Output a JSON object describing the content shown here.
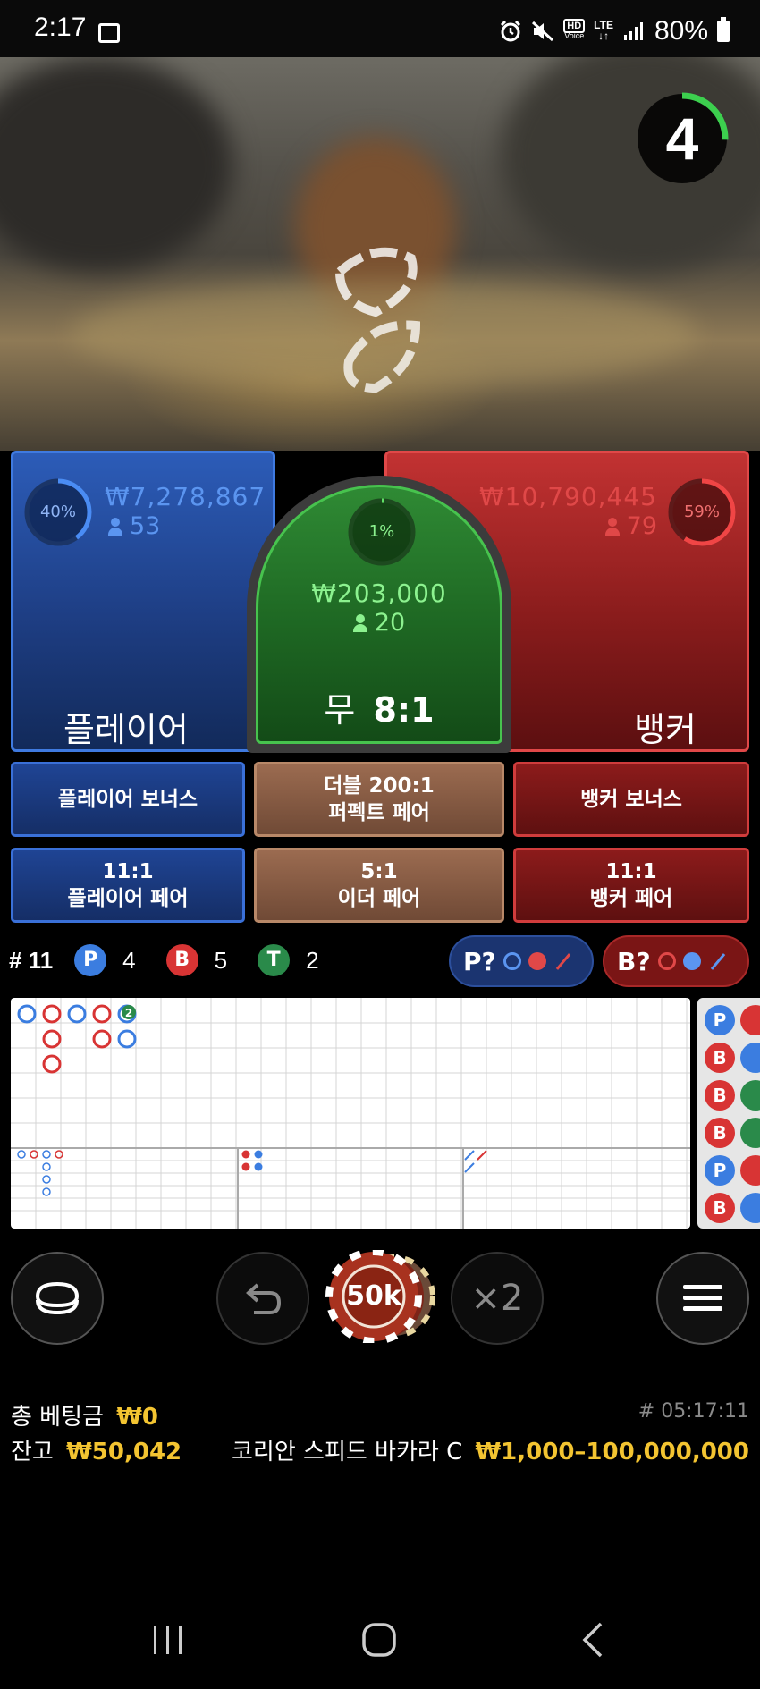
{
  "status_bar": {
    "time": "2:17",
    "battery": "80%",
    "icons": [
      "image-icon",
      "alarm-icon",
      "mute-icon",
      "hd-voice-icon",
      "lte-icon",
      "signal-icon",
      "battery-icon"
    ],
    "hd_label": "HD",
    "voice_label": "Voice",
    "lte_label": "LTE"
  },
  "timer": {
    "value": "4"
  },
  "player": {
    "percent": "40%",
    "amount": "₩7,278,867",
    "people": "53",
    "label": "플레이어"
  },
  "tie": {
    "percent": "1%",
    "amount": "₩203,000",
    "people": "20",
    "label_prefix": "무",
    "label_odds": "8:1"
  },
  "banker": {
    "percent": "59%",
    "amount": "₩10,790,445",
    "people": "79",
    "label": "뱅커"
  },
  "side_bets": {
    "player_bonus": "플레이어 보너스",
    "perfect_pair_line1": "더블 200:1",
    "perfect_pair_line2": "퍼펙트 페어",
    "banker_bonus": "뱅커 보너스",
    "player_pair_line1": "11:1",
    "player_pair_line2": "플레이어 페어",
    "either_pair_line1": "5:1",
    "either_pair_line2": "이더 페어",
    "banker_pair_line1": "11:1",
    "banker_pair_line2": "뱅커 페어"
  },
  "stats": {
    "round_label": "# 11",
    "p_badge": "P",
    "p_count": "4",
    "b_badge": "B",
    "b_count": "5",
    "t_badge": "T",
    "t_count": "2",
    "player_predict": "P?",
    "banker_predict": "B?"
  },
  "bead_road": [
    "P",
    "B",
    "B",
    "B",
    "P",
    "B"
  ],
  "big_road_tie_marker": "2",
  "controls": {
    "chip_value": "50k",
    "double_label": "×2"
  },
  "footer": {
    "total_bet_label": "총 베팅금",
    "total_bet_value": "₩0",
    "balance_label": "잔고",
    "balance_value": "₩50,042",
    "game_id": "# 05:17:11",
    "table_name": "코리안 스피드 바카라 C",
    "limits": "₩1,000–100,000,000"
  },
  "colors": {
    "player_blue": "#3f7ae0",
    "banker_red": "#e04848",
    "tie_green": "#47c34e",
    "gold": "#f3c431",
    "player_amount": "#5b95f0",
    "banker_amount": "#e04848",
    "tie_amount": "#8cf28f"
  }
}
